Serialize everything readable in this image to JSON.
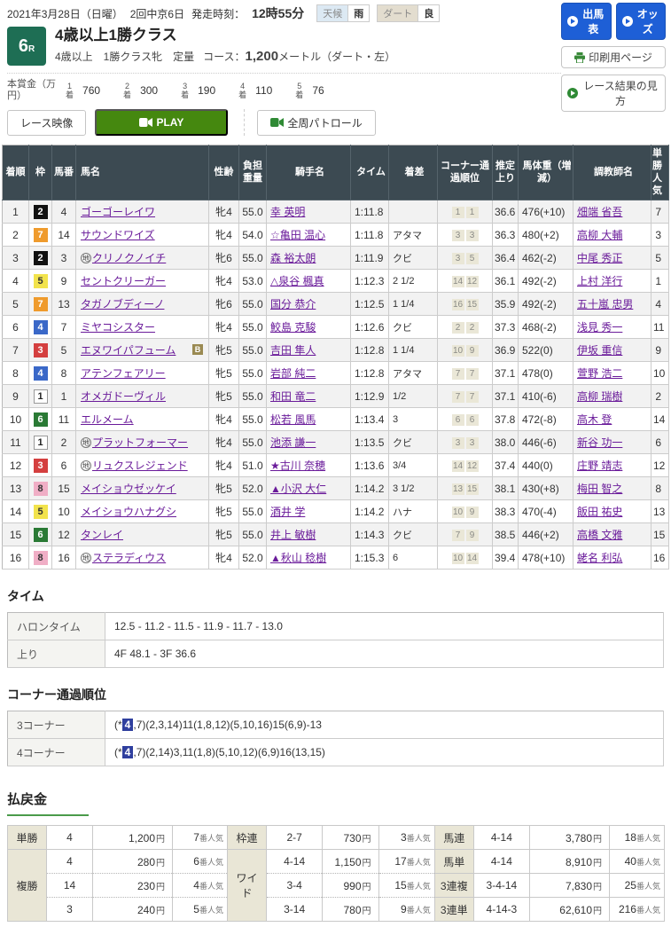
{
  "header": {
    "date": "2021年3月28日（日曜）",
    "meeting": "2回中京6日",
    "start_label": "発走時刻：",
    "start_time": "12時55分",
    "weather_label": "天候",
    "weather_value": "雨",
    "track_label": "ダート",
    "track_value": "良",
    "buttons": {
      "entry": "出馬表",
      "odds": "オッズ",
      "print": "印刷用ページ",
      "guide": "レース結果の見方"
    }
  },
  "race": {
    "number": "6",
    "number_suffix": "R",
    "title": "4歳以上1勝クラス",
    "conditions": "4歳以上　1勝クラス牝　定量",
    "course_label": "コース：",
    "course_value": "1,200",
    "course_unit": "メートル（ダート・左）"
  },
  "prize": {
    "label": "本賞金（万円）",
    "suffix": "着",
    "items": [
      {
        "no": "1",
        "amount": "760"
      },
      {
        "no": "2",
        "amount": "300"
      },
      {
        "no": "3",
        "amount": "190"
      },
      {
        "no": "4",
        "amount": "110"
      },
      {
        "no": "5",
        "amount": "76"
      }
    ]
  },
  "video": {
    "race_video": "レース映像",
    "play": "PLAY",
    "patrol": "全周パトロール"
  },
  "icons": {
    "arrow-circle-icon": "right-chevron-in-circle",
    "printer-icon": "printer-glyph",
    "camera-icon": "video-camera-glyph"
  },
  "results": {
    "headers": [
      "着順",
      "枠",
      "馬番",
      "馬名",
      "性齢",
      "負担重量",
      "騎手名",
      "タイム",
      "着差",
      "コーナー通過順位",
      "推定上り",
      "馬体重（増減）",
      "調教師名",
      "単勝人気"
    ],
    "rows": [
      {
        "rank": "1",
        "frame": "2",
        "no": "4",
        "mark": "",
        "horse": "ゴーゴーレイワ",
        "blinker": "",
        "sexage": "牝4",
        "weight": "55.0",
        "jockey": "幸 英明",
        "time": "1:11.8",
        "margin": "",
        "c1": "1",
        "c2": "1",
        "agari": "36.6",
        "body": "476(+10)",
        "trainer": "畑端 省吾",
        "fav": "7"
      },
      {
        "rank": "2",
        "frame": "7",
        "no": "14",
        "mark": "",
        "horse": "サウンドワイズ",
        "blinker": "",
        "sexage": "牝4",
        "weight": "54.0",
        "jockey": "☆亀田 温心",
        "time": "1:11.8",
        "margin": "アタマ",
        "c1": "3",
        "c2": "3",
        "agari": "36.3",
        "body": "480(+2)",
        "trainer": "高柳 大輔",
        "fav": "3"
      },
      {
        "rank": "3",
        "frame": "2",
        "no": "3",
        "mark": "地",
        "horse": "クリノクノイチ",
        "blinker": "",
        "sexage": "牝6",
        "weight": "55.0",
        "jockey": "森 裕太朗",
        "time": "1:11.9",
        "margin": "クビ",
        "c1": "3",
        "c2": "5",
        "agari": "36.4",
        "body": "462(-2)",
        "trainer": "中尾 秀正",
        "fav": "5"
      },
      {
        "rank": "4",
        "frame": "5",
        "no": "9",
        "mark": "",
        "horse": "セントクリーガー",
        "blinker": "",
        "sexage": "牝4",
        "weight": "53.0",
        "jockey": "△泉谷 楓真",
        "time": "1:12.3",
        "margin": "2 1/2",
        "c1": "14",
        "c2": "12",
        "agari": "36.1",
        "body": "492(-2)",
        "trainer": "上村 洋行",
        "fav": "1"
      },
      {
        "rank": "5",
        "frame": "7",
        "no": "13",
        "mark": "",
        "horse": "タガノブディーノ",
        "blinker": "",
        "sexage": "牝6",
        "weight": "55.0",
        "jockey": "国分 恭介",
        "time": "1:12.5",
        "margin": "1 1/4",
        "c1": "16",
        "c2": "15",
        "agari": "35.9",
        "body": "492(-2)",
        "trainer": "五十嵐 忠男",
        "fav": "4"
      },
      {
        "rank": "6",
        "frame": "4",
        "no": "7",
        "mark": "",
        "horse": "ミヤコシスター",
        "blinker": "",
        "sexage": "牝4",
        "weight": "55.0",
        "jockey": "鮫島 克駿",
        "time": "1:12.6",
        "margin": "クビ",
        "c1": "2",
        "c2": "2",
        "agari": "37.3",
        "body": "468(-2)",
        "trainer": "浅見 秀一",
        "fav": "11"
      },
      {
        "rank": "7",
        "frame": "3",
        "no": "5",
        "mark": "",
        "horse": "エヌワイパフューム",
        "blinker": "B",
        "sexage": "牝5",
        "weight": "55.0",
        "jockey": "吉田 隼人",
        "time": "1:12.8",
        "margin": "1 1/4",
        "c1": "10",
        "c2": "9",
        "agari": "36.9",
        "body": "522(0)",
        "trainer": "伊坂 重信",
        "fav": "9"
      },
      {
        "rank": "8",
        "frame": "4",
        "no": "8",
        "mark": "",
        "horse": "アテンフェアリー",
        "blinker": "",
        "sexage": "牝5",
        "weight": "55.0",
        "jockey": "岩部 純二",
        "time": "1:12.8",
        "margin": "アタマ",
        "c1": "7",
        "c2": "7",
        "agari": "37.1",
        "body": "478(0)",
        "trainer": "萱野 浩二",
        "fav": "10"
      },
      {
        "rank": "9",
        "frame": "1",
        "no": "1",
        "mark": "",
        "horse": "オメガドーヴィル",
        "blinker": "",
        "sexage": "牝5",
        "weight": "55.0",
        "jockey": "和田 竜二",
        "time": "1:12.9",
        "margin": "1/2",
        "c1": "7",
        "c2": "7",
        "agari": "37.1",
        "body": "410(-6)",
        "trainer": "高柳 瑞樹",
        "fav": "2"
      },
      {
        "rank": "10",
        "frame": "6",
        "no": "11",
        "mark": "",
        "horse": "エルメーム",
        "blinker": "",
        "sexage": "牝4",
        "weight": "55.0",
        "jockey": "松若 風馬",
        "time": "1:13.4",
        "margin": "3",
        "c1": "6",
        "c2": "6",
        "agari": "37.8",
        "body": "472(-8)",
        "trainer": "高木 登",
        "fav": "14"
      },
      {
        "rank": "11",
        "frame": "1",
        "no": "2",
        "mark": "地",
        "horse": "プラットフォーマー",
        "blinker": "",
        "sexage": "牝4",
        "weight": "55.0",
        "jockey": "池添 謙一",
        "time": "1:13.5",
        "margin": "クビ",
        "c1": "3",
        "c2": "3",
        "agari": "38.0",
        "body": "446(-6)",
        "trainer": "新谷 功一",
        "fav": "6"
      },
      {
        "rank": "12",
        "frame": "3",
        "no": "6",
        "mark": "地",
        "horse": "リュクスレジェンド",
        "blinker": "",
        "sexage": "牝4",
        "weight": "51.0",
        "jockey": "★古川 奈穂",
        "time": "1:13.6",
        "margin": "3/4",
        "c1": "14",
        "c2": "12",
        "agari": "37.4",
        "body": "440(0)",
        "trainer": "庄野 靖志",
        "fav": "12"
      },
      {
        "rank": "13",
        "frame": "8",
        "no": "15",
        "mark": "",
        "horse": "メイショウゼッケイ",
        "blinker": "",
        "sexage": "牝5",
        "weight": "52.0",
        "jockey": "▲小沢 大仁",
        "time": "1:14.2",
        "margin": "3 1/2",
        "c1": "13",
        "c2": "15",
        "agari": "38.1",
        "body": "430(+8)",
        "trainer": "梅田 智之",
        "fav": "8"
      },
      {
        "rank": "14",
        "frame": "5",
        "no": "10",
        "mark": "",
        "horse": "メイショウハナグシ",
        "blinker": "",
        "sexage": "牝5",
        "weight": "55.0",
        "jockey": "酒井 学",
        "time": "1:14.2",
        "margin": "ハナ",
        "c1": "10",
        "c2": "9",
        "agari": "38.3",
        "body": "470(-4)",
        "trainer": "飯田 祐史",
        "fav": "13"
      },
      {
        "rank": "15",
        "frame": "6",
        "no": "12",
        "mark": "",
        "horse": "タンレイ",
        "blinker": "",
        "sexage": "牝5",
        "weight": "55.0",
        "jockey": "井上 敏樹",
        "time": "1:14.3",
        "margin": "クビ",
        "c1": "7",
        "c2": "9",
        "agari": "38.5",
        "body": "446(+2)",
        "trainer": "高橋 文雅",
        "fav": "15"
      },
      {
        "rank": "16",
        "frame": "8",
        "no": "16",
        "mark": "地",
        "horse": "ステラディウス",
        "blinker": "",
        "sexage": "牝4",
        "weight": "52.0",
        "jockey": "▲秋山 稔樹",
        "time": "1:15.3",
        "margin": "6",
        "c1": "10",
        "c2": "14",
        "agari": "39.4",
        "body": "478(+10)",
        "trainer": "蛯名 利弘",
        "fav": "16"
      }
    ]
  },
  "time_section": {
    "title": "タイム",
    "rows": [
      {
        "label": "ハロンタイム",
        "value": "12.5 - 11.2 - 11.5 - 11.9 - 11.7 - 13.0"
      },
      {
        "label": "上り",
        "value": "4F 48.1 - 3F 36.6"
      }
    ]
  },
  "corner_section": {
    "title": "コーナー通過順位",
    "rows": [
      {
        "label": "3コーナー",
        "prefix": "(*",
        "highlight": "4",
        "rest": ",7)(2,3,14)11(1,8,12)(5,10,16)15(6,9)-13"
      },
      {
        "label": "4コーナー",
        "prefix": "(*",
        "highlight": "4",
        "rest": ",7)(2,14)3,11(1,8)(5,10,12)(6,9)16(13,15)"
      }
    ]
  },
  "payout": {
    "title": "払戻金",
    "yen": "円",
    "fav_suffix": "番人気",
    "win": {
      "label": "単勝",
      "combo": "4",
      "amount": "1,200",
      "fav": "7"
    },
    "place": {
      "label": "複勝",
      "rows": [
        {
          "combo": "4",
          "amount": "280",
          "fav": "6"
        },
        {
          "combo": "14",
          "amount": "230",
          "fav": "4"
        },
        {
          "combo": "3",
          "amount": "240",
          "fav": "5"
        }
      ]
    },
    "bracket": {
      "label": "枠連",
      "combo": "2-7",
      "amount": "730",
      "fav": "3"
    },
    "wide": {
      "label": "ワイド",
      "rows": [
        {
          "combo": "4-14",
          "amount": "1,150",
          "fav": "17"
        },
        {
          "combo": "3-4",
          "amount": "990",
          "fav": "15"
        },
        {
          "combo": "3-14",
          "amount": "780",
          "fav": "9"
        }
      ]
    },
    "quinella": {
      "label": "馬連",
      "combo": "4-14",
      "amount": "3,780",
      "fav": "18"
    },
    "exacta": {
      "label": "馬単",
      "combo": "4-14",
      "amount": "8,910",
      "fav": "40"
    },
    "trio": {
      "label": "3連複",
      "combo": "3-4-14",
      "amount": "7,830",
      "fav": "25"
    },
    "trifecta": {
      "label": "3連単",
      "combo": "4-14-3",
      "amount": "62,610",
      "fav": "216"
    }
  }
}
